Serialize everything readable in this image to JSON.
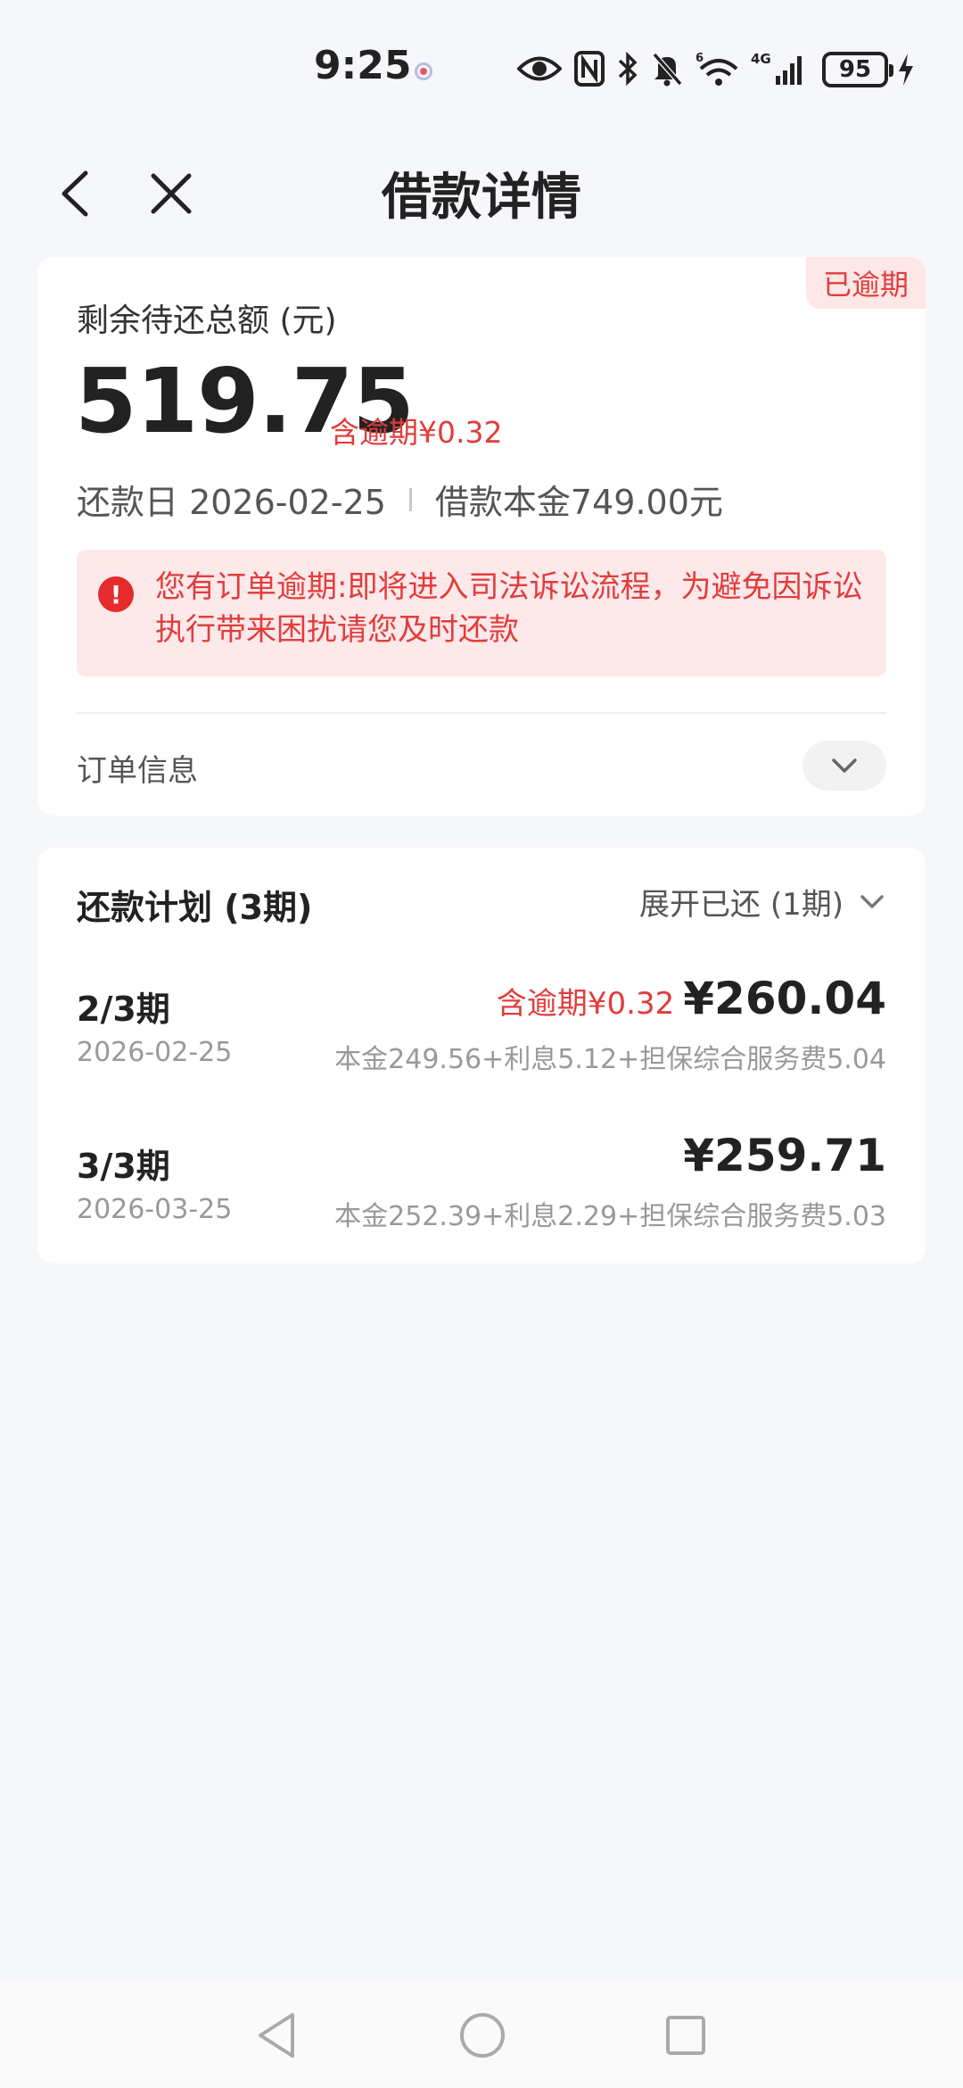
{
  "status_bar": {
    "time": "9:25",
    "battery": "95",
    "network": "4G",
    "wifi_badge": "6"
  },
  "nav": {
    "title": "借款详情"
  },
  "summary": {
    "overdue_tag": "已逾期",
    "remain_label": "剩余待还总额 (元)",
    "remain_amount": "519.75",
    "remain_overdue": "含逾期¥0.32",
    "due_label": "还款日 2026-02-25",
    "principal_label": "借款本金749.00元",
    "alert_text": "您有订单逾期:即将进入司法诉讼流程，为避免因诉讼执行带来困扰请您及时还款",
    "order_info_label": "订单信息"
  },
  "plan": {
    "title": "还款计划 (3期)",
    "expand_label": "展开已还 (1期)",
    "rows": [
      {
        "period": "2/3期",
        "date": "2026-02-25",
        "overdue": "含逾期¥0.32",
        "amount": "¥260.04",
        "breakdown": "本金249.56+利息5.12+担保综合服务费5.04"
      },
      {
        "period": "3/3期",
        "date": "2026-03-25",
        "overdue": "",
        "amount": "¥259.71",
        "breakdown": "本金252.39+利息2.29+担保综合服务费5.03"
      }
    ]
  },
  "colors": {
    "accent_red": "#e23c3c",
    "alert_bg": "#fde9ea",
    "page_bg": "#f6f7fb"
  },
  "icons": [
    "back-icon",
    "close-icon",
    "alert-icon",
    "chevron-down-icon",
    "eye-icon",
    "nfc-icon",
    "bluetooth-icon",
    "mute-icon",
    "wifi-icon",
    "signal-icon",
    "battery-icon",
    "charging-icon"
  ]
}
